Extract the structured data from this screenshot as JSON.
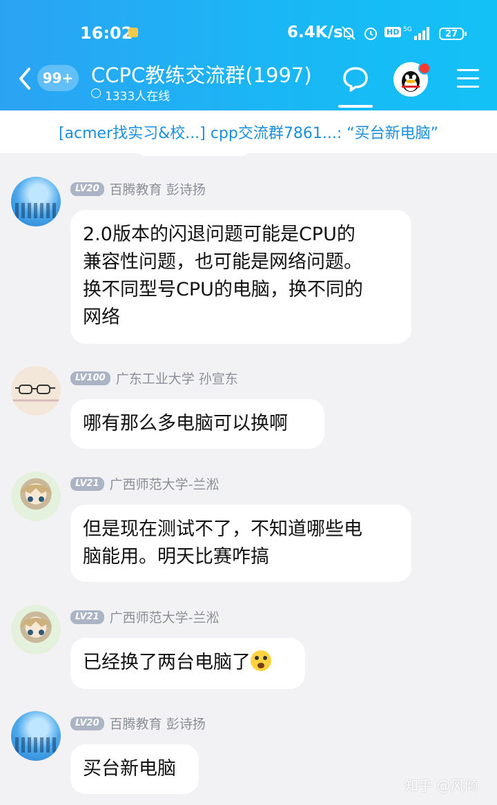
{
  "status_bar": {
    "time": "16:02",
    "net_speed": "6.4K/s",
    "hd": "HD",
    "net_type": "5G",
    "battery": "27"
  },
  "header": {
    "back_badge": "99+",
    "title": "CCPC教练交流群(1997)",
    "online": "1333人在线",
    "icons": [
      "back-chevron-icon",
      "chat-bubble-icon",
      "qq-avatar-icon",
      "menu-icon"
    ]
  },
  "banner": {
    "text": "[acmer找实习&校...] cpp交流群7861...: “买台新电脑”"
  },
  "messages": [
    {
      "level": "LV20",
      "sender": "百腾教育 彭诗扬",
      "text": "2.0版本的闪退问题可能是CPU的\n兼容性问题，也可能是网络问题。\n换不同型号CPU的电脑，换不同的\n网络"
    },
    {
      "level": "LV100",
      "sender": "广东工业大学 孙宣东",
      "text": "哪有那么多电脑可以换啊"
    },
    {
      "level": "LV21",
      "sender": "广西师范大学-兰淞",
      "text": "但是现在测试不了，不知道哪些电\n脑能用。明天比赛咋搞"
    },
    {
      "level": "LV21",
      "sender": "广西师范大学-兰淞",
      "text": "已经换了两台电脑了",
      "emoji": "shocked-face-emoji"
    },
    {
      "level": "LV20",
      "sender": "百腾教育 彭诗扬",
      "text": "买台新电脑"
    }
  ],
  "watermark": "知乎 @风倾",
  "colors": {
    "header_start": "#2ba3f3",
    "header_end": "#13c1f6",
    "banner_text": "#1a8fe0",
    "background": "#f2f2f4"
  }
}
